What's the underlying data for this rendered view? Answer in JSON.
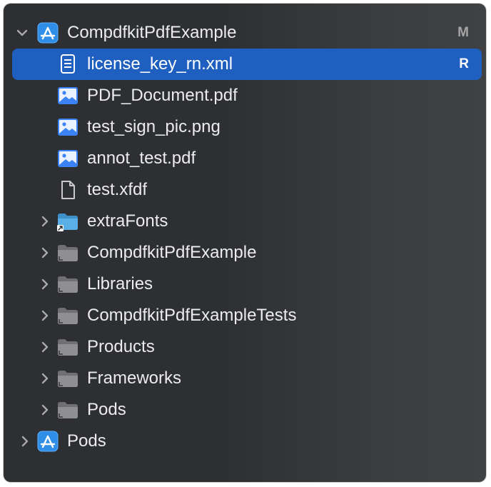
{
  "tree": {
    "root": {
      "label": "CompdfkitPdfExample",
      "badge": "M",
      "expanded": true,
      "icon": "xcode-project-icon"
    },
    "files": [
      {
        "label": "license_key_rn.xml",
        "badge": "R",
        "icon": "document-text-icon",
        "selected": true
      },
      {
        "label": "PDF_Document.pdf",
        "badge": "",
        "icon": "image-file-icon"
      },
      {
        "label": "test_sign_pic.png",
        "badge": "",
        "icon": "image-file-icon"
      },
      {
        "label": "annot_test.pdf",
        "badge": "",
        "icon": "image-file-icon"
      },
      {
        "label": "test.xfdf",
        "badge": "",
        "icon": "blank-document-icon"
      }
    ],
    "groups": [
      {
        "label": "extraFonts",
        "icon": "folder-alias-icon",
        "expanded": false
      },
      {
        "label": "CompdfkitPdfExample",
        "icon": "folder-group-icon",
        "expanded": false
      },
      {
        "label": "Libraries",
        "icon": "folder-group-icon",
        "expanded": false
      },
      {
        "label": "CompdfkitPdfExampleTests",
        "icon": "folder-group-icon",
        "expanded": false
      },
      {
        "label": "Products",
        "icon": "folder-group-icon",
        "expanded": false
      },
      {
        "label": "Frameworks",
        "icon": "folder-group-icon",
        "expanded": false
      },
      {
        "label": "Pods",
        "icon": "folder-group-icon",
        "expanded": false
      }
    ],
    "second_project": {
      "label": "Pods",
      "badge": "",
      "expanded": false,
      "icon": "xcode-project-icon"
    }
  },
  "colors": {
    "selection": "#1f5fbf",
    "project_icon": "#2f8fe8",
    "image_icon": "#3b82f6",
    "folder_group": "#8e8e93",
    "folder_blue": "#5ab0e6"
  }
}
